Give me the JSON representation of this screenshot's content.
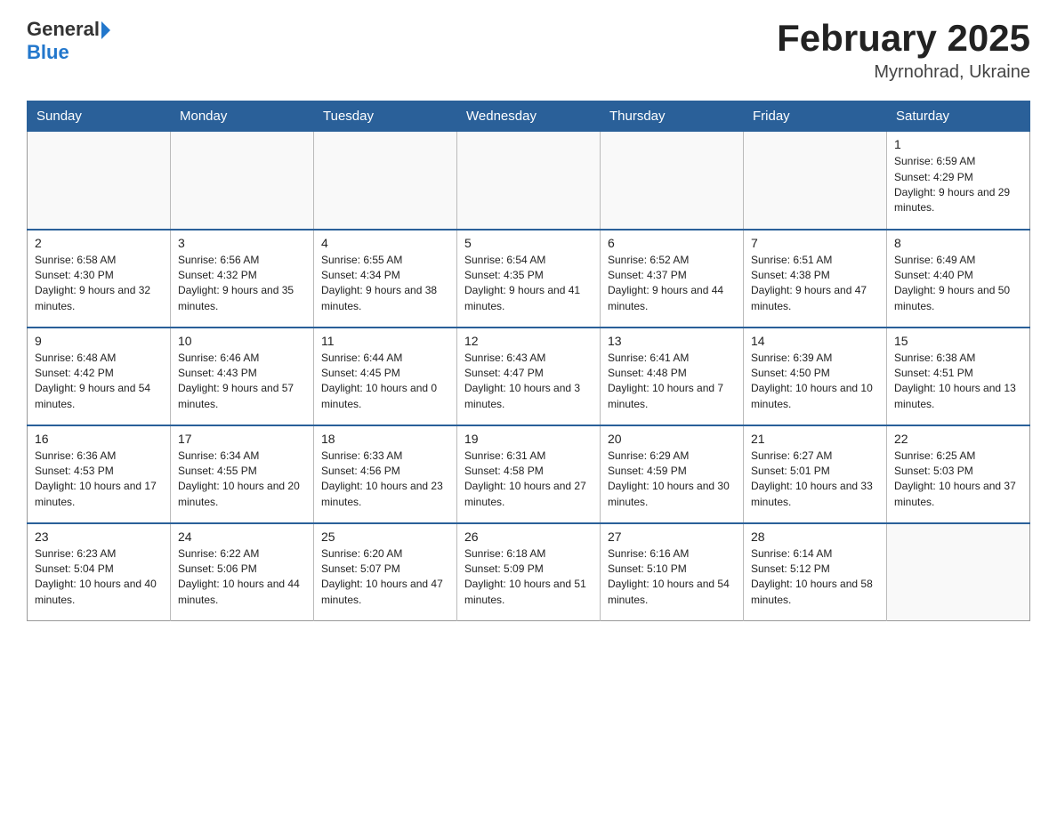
{
  "header": {
    "logo_general": "General",
    "logo_blue": "Blue",
    "month_year": "February 2025",
    "location": "Myrnohrad, Ukraine"
  },
  "days_of_week": [
    "Sunday",
    "Monday",
    "Tuesday",
    "Wednesday",
    "Thursday",
    "Friday",
    "Saturday"
  ],
  "weeks": [
    [
      {
        "day": "",
        "info": ""
      },
      {
        "day": "",
        "info": ""
      },
      {
        "day": "",
        "info": ""
      },
      {
        "day": "",
        "info": ""
      },
      {
        "day": "",
        "info": ""
      },
      {
        "day": "",
        "info": ""
      },
      {
        "day": "1",
        "info": "Sunrise: 6:59 AM\nSunset: 4:29 PM\nDaylight: 9 hours and 29 minutes."
      }
    ],
    [
      {
        "day": "2",
        "info": "Sunrise: 6:58 AM\nSunset: 4:30 PM\nDaylight: 9 hours and 32 minutes."
      },
      {
        "day": "3",
        "info": "Sunrise: 6:56 AM\nSunset: 4:32 PM\nDaylight: 9 hours and 35 minutes."
      },
      {
        "day": "4",
        "info": "Sunrise: 6:55 AM\nSunset: 4:34 PM\nDaylight: 9 hours and 38 minutes."
      },
      {
        "day": "5",
        "info": "Sunrise: 6:54 AM\nSunset: 4:35 PM\nDaylight: 9 hours and 41 minutes."
      },
      {
        "day": "6",
        "info": "Sunrise: 6:52 AM\nSunset: 4:37 PM\nDaylight: 9 hours and 44 minutes."
      },
      {
        "day": "7",
        "info": "Sunrise: 6:51 AM\nSunset: 4:38 PM\nDaylight: 9 hours and 47 minutes."
      },
      {
        "day": "8",
        "info": "Sunrise: 6:49 AM\nSunset: 4:40 PM\nDaylight: 9 hours and 50 minutes."
      }
    ],
    [
      {
        "day": "9",
        "info": "Sunrise: 6:48 AM\nSunset: 4:42 PM\nDaylight: 9 hours and 54 minutes."
      },
      {
        "day": "10",
        "info": "Sunrise: 6:46 AM\nSunset: 4:43 PM\nDaylight: 9 hours and 57 minutes."
      },
      {
        "day": "11",
        "info": "Sunrise: 6:44 AM\nSunset: 4:45 PM\nDaylight: 10 hours and 0 minutes."
      },
      {
        "day": "12",
        "info": "Sunrise: 6:43 AM\nSunset: 4:47 PM\nDaylight: 10 hours and 3 minutes."
      },
      {
        "day": "13",
        "info": "Sunrise: 6:41 AM\nSunset: 4:48 PM\nDaylight: 10 hours and 7 minutes."
      },
      {
        "day": "14",
        "info": "Sunrise: 6:39 AM\nSunset: 4:50 PM\nDaylight: 10 hours and 10 minutes."
      },
      {
        "day": "15",
        "info": "Sunrise: 6:38 AM\nSunset: 4:51 PM\nDaylight: 10 hours and 13 minutes."
      }
    ],
    [
      {
        "day": "16",
        "info": "Sunrise: 6:36 AM\nSunset: 4:53 PM\nDaylight: 10 hours and 17 minutes."
      },
      {
        "day": "17",
        "info": "Sunrise: 6:34 AM\nSunset: 4:55 PM\nDaylight: 10 hours and 20 minutes."
      },
      {
        "day": "18",
        "info": "Sunrise: 6:33 AM\nSunset: 4:56 PM\nDaylight: 10 hours and 23 minutes."
      },
      {
        "day": "19",
        "info": "Sunrise: 6:31 AM\nSunset: 4:58 PM\nDaylight: 10 hours and 27 minutes."
      },
      {
        "day": "20",
        "info": "Sunrise: 6:29 AM\nSunset: 4:59 PM\nDaylight: 10 hours and 30 minutes."
      },
      {
        "day": "21",
        "info": "Sunrise: 6:27 AM\nSunset: 5:01 PM\nDaylight: 10 hours and 33 minutes."
      },
      {
        "day": "22",
        "info": "Sunrise: 6:25 AM\nSunset: 5:03 PM\nDaylight: 10 hours and 37 minutes."
      }
    ],
    [
      {
        "day": "23",
        "info": "Sunrise: 6:23 AM\nSunset: 5:04 PM\nDaylight: 10 hours and 40 minutes."
      },
      {
        "day": "24",
        "info": "Sunrise: 6:22 AM\nSunset: 5:06 PM\nDaylight: 10 hours and 44 minutes."
      },
      {
        "day": "25",
        "info": "Sunrise: 6:20 AM\nSunset: 5:07 PM\nDaylight: 10 hours and 47 minutes."
      },
      {
        "day": "26",
        "info": "Sunrise: 6:18 AM\nSunset: 5:09 PM\nDaylight: 10 hours and 51 minutes."
      },
      {
        "day": "27",
        "info": "Sunrise: 6:16 AM\nSunset: 5:10 PM\nDaylight: 10 hours and 54 minutes."
      },
      {
        "day": "28",
        "info": "Sunrise: 6:14 AM\nSunset: 5:12 PM\nDaylight: 10 hours and 58 minutes."
      },
      {
        "day": "",
        "info": ""
      }
    ]
  ]
}
